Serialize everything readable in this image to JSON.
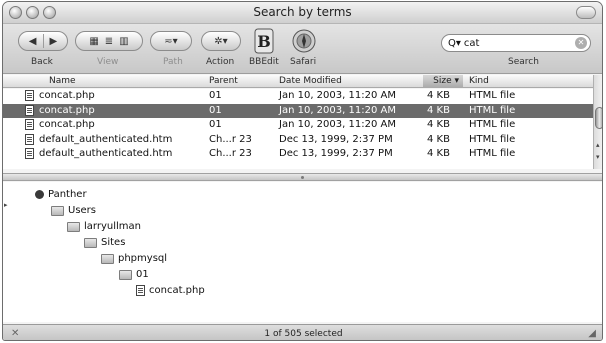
{
  "window": {
    "title": "Search by terms"
  },
  "toolbar": {
    "back_label": "Back",
    "view_label": "View",
    "path_label": "Path",
    "action_label": "Action",
    "bbedit_label": "BBEdit",
    "safari_label": "Safari",
    "search_label": "Search",
    "search_value": "cat"
  },
  "columns": {
    "name": "Name",
    "parent": "Parent",
    "date": "Date Modified",
    "size": "Size",
    "kind": "Kind"
  },
  "rows": [
    {
      "name": "concat.php",
      "parent": "01",
      "date": "Jan 10, 2003, 11:20 AM",
      "size": "4 KB",
      "kind": "HTML file"
    },
    {
      "name": "concat.php",
      "parent": "01",
      "date": "Jan 10, 2003, 11:20 AM",
      "size": "4 KB",
      "kind": "HTML file"
    },
    {
      "name": "concat.php",
      "parent": "01",
      "date": "Jan 10, 2003, 11:20 AM",
      "size": "4 KB",
      "kind": "HTML file"
    },
    {
      "name": "default_authenticated.htm",
      "parent": "Ch...r 23",
      "date": "Dec 13, 1999, 2:37 PM",
      "size": "4 KB",
      "kind": "HTML file"
    },
    {
      "name": "default_authenticated.htm",
      "parent": "Ch...r 23",
      "date": "Dec 13, 1999, 2:37 PM",
      "size": "4 KB",
      "kind": "HTML file"
    }
  ],
  "selected_row_index": 1,
  "path": [
    "Panther",
    "Users",
    "larryullman",
    "Sites",
    "phpmysql",
    "01",
    "concat.php"
  ],
  "status": {
    "text": "1 of 505 selected"
  },
  "icons": {
    "back": "back-arrow-icon",
    "forward": "forward-arrow-icon",
    "view_icons": "icon-view-icon",
    "view_list": "list-view-icon",
    "view_columns": "column-view-icon",
    "path": "path-menu-icon",
    "action": "gear-icon",
    "bbedit": "bbedit-app-icon",
    "safari": "safari-compass-icon",
    "search": "magnifier-icon",
    "clear": "clear-search-icon"
  },
  "colors": {
    "selection": "#6b6b6b",
    "window": "#f4f4f4"
  }
}
